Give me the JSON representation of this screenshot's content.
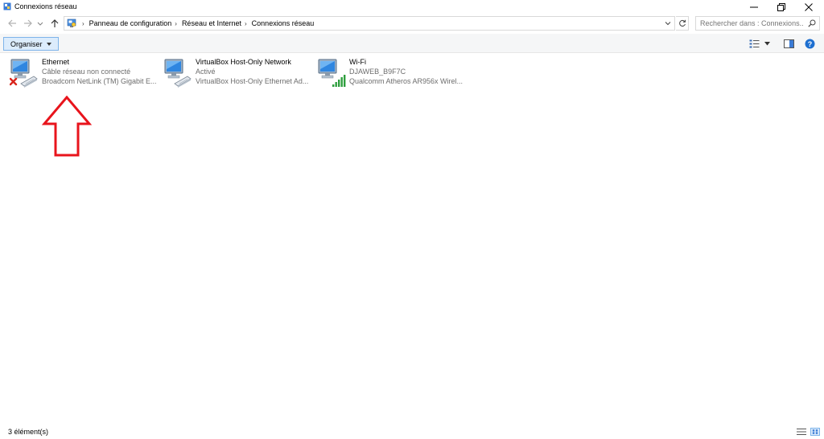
{
  "window": {
    "title": "Connexions réseau"
  },
  "address_bar": {
    "breadcrumbs": [
      "Panneau de configuration",
      "Réseau et Internet",
      "Connexions réseau"
    ]
  },
  "search": {
    "placeholder": "Rechercher dans : Connexions..."
  },
  "toolbar": {
    "organize_label": "Organiser"
  },
  "connections": [
    {
      "name": "Ethernet",
      "status": "Câble réseau non connecté",
      "device": "Broadcom NetLink (TM) Gigabit E...",
      "icon": "ethernet-disconnected-icon"
    },
    {
      "name": "VirtualBox Host-Only Network",
      "status": "Activé",
      "device": "VirtualBox Host-Only Ethernet Ad...",
      "icon": "network-adapter-icon"
    },
    {
      "name": "Wi-Fi",
      "status": "DJAWEB_B9F7C",
      "device": "Qualcomm Atheros AR956x Wirel...",
      "icon": "wifi-signal-icon"
    }
  ],
  "status_bar": {
    "item_count": "3 élément(s)"
  },
  "colors": {
    "accent": "#0078d7",
    "organize_bg": "#dcecfc",
    "annotation_arrow": "#e8141c",
    "disconnected_x": "#d9251c",
    "wifi_green": "#2e9e3e"
  }
}
